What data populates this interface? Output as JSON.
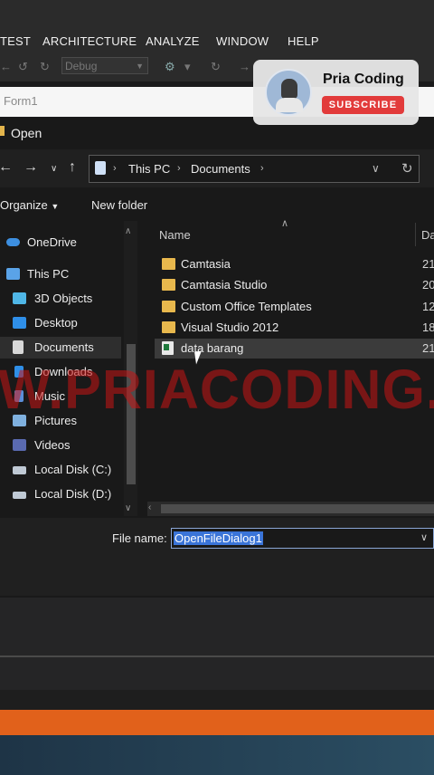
{
  "menu": {
    "items": [
      "TEST",
      "ARCHITECTURE",
      "ANALYZE",
      "WINDOW",
      "HELP"
    ]
  },
  "toolbar": {
    "configuration": "Debug"
  },
  "form": {
    "title": "Form1"
  },
  "dialog": {
    "title": "Open",
    "address": {
      "segments": [
        "This PC",
        "Documents"
      ]
    },
    "commands": {
      "organize": "Organize",
      "new_folder": "New folder"
    },
    "nav_items": [
      "OneDrive",
      "This PC",
      "3D Objects",
      "Desktop",
      "Documents",
      "Downloads",
      "Music",
      "Pictures",
      "Videos",
      "Local Disk (C:)",
      "Local Disk (D:)"
    ],
    "selected_nav": "Documents",
    "columns": {
      "name": "Name",
      "date": "Da"
    },
    "files": [
      {
        "name": "Camtasia",
        "date": "21",
        "type": "folder"
      },
      {
        "name": "Camtasia Studio",
        "date": "20",
        "type": "folder"
      },
      {
        "name": "Custom Office Templates",
        "date": "12",
        "type": "folder"
      },
      {
        "name": "Visual Studio 2012",
        "date": "18",
        "type": "folder"
      },
      {
        "name": "data barang",
        "date": "21",
        "type": "excel-file"
      }
    ],
    "file_name_label": "File name:",
    "file_name_value": "OpenFileDialog1"
  },
  "watermark": "W.PRIACODING.",
  "channel": {
    "name": "Pria Coding",
    "subscribe": "SUBSCRIBE"
  },
  "colors": {
    "folder": "#e8b84d",
    "selection": "#3a74d8",
    "subscribe": "#e23b3b",
    "watermark": "#c81414",
    "orange_bar": "#e1611b"
  }
}
